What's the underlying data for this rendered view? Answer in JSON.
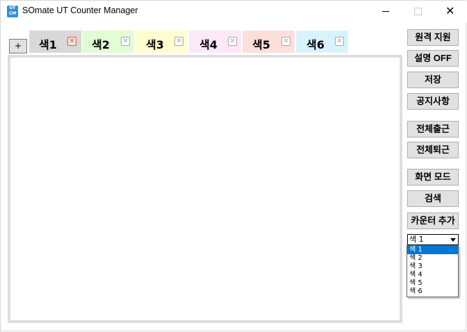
{
  "window": {
    "title": "SOmate UT Counter Manager",
    "icon_name": "app-logo-icon",
    "icon_text_top": "UT",
    "icon_text_bottom": "CM",
    "controls": {
      "minimize_icon": "minimize-icon",
      "maximize_icon": "maximize-icon",
      "close_glyph": "✕"
    }
  },
  "add_tab_label": "+",
  "tabs": [
    {
      "label": "색1",
      "color": "#d8d8d8",
      "close": "✕",
      "close_color": "#e2573d",
      "active": true
    },
    {
      "label": "색2",
      "color": "#e2fcd4",
      "close": "✕",
      "close_color": "#a6a6a6"
    },
    {
      "label": "색3",
      "color": "#fffccf",
      "close": "✕",
      "close_color": "#a6a6a6"
    },
    {
      "label": "색4",
      "color": "#fce8f7",
      "close": "✕",
      "close_color": "#a6a6a6"
    },
    {
      "label": "색5",
      "color": "#fddfd9",
      "close": "✕",
      "close_color": "#a6a6a6"
    },
    {
      "label": "색6",
      "color": "#d9f3fd",
      "close": "✕",
      "close_color": "#a6a6a6"
    }
  ],
  "sidebar": {
    "buttons": [
      {
        "id": "remote",
        "label": "원격 지원"
      },
      {
        "id": "desc",
        "label": "설명 OFF"
      },
      {
        "id": "save",
        "label": "저장"
      },
      {
        "id": "notice",
        "label": "공지사항"
      },
      {
        "id": "all-in",
        "label": "전체출근"
      },
      {
        "id": "all-out",
        "label": "전체퇴근"
      },
      {
        "id": "screen-mode",
        "label": "화면 모드"
      },
      {
        "id": "search",
        "label": "검색"
      },
      {
        "id": "add-counter",
        "label": "카운터 추가"
      }
    ],
    "select": {
      "value": "색 1",
      "options": [
        "색 1",
        "색 2",
        "색 3",
        "색 4",
        "색 5",
        "색 6"
      ],
      "highlight_color": "#0078d7"
    }
  }
}
